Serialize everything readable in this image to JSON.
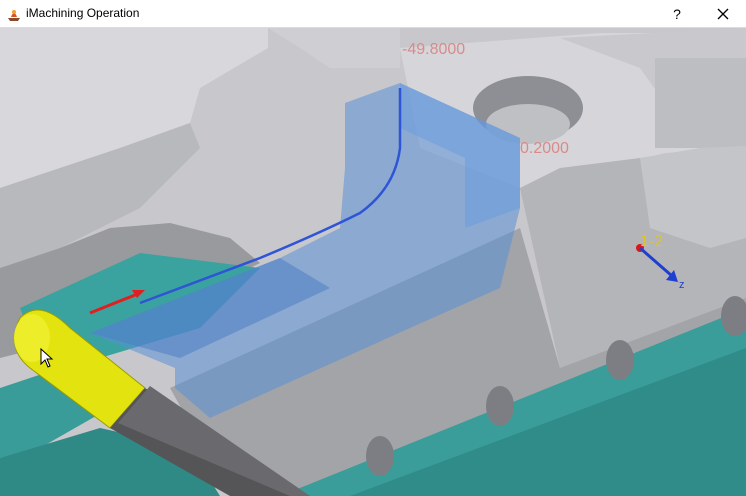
{
  "window": {
    "title": "iMachining Operation",
    "help_label": "?",
    "app_icon": "imachining-app-icon",
    "close_icon": "close-icon"
  },
  "viewport": {
    "dimension_labels": [
      "-49.8000",
      "0.2000"
    ],
    "axis_label": "1-2",
    "axis_letter": "z",
    "colors": {
      "part_face": "#d2d2d6",
      "part_face_light": "#e4e4e8",
      "part_wall": "#a7a8ac",
      "part_dark": "#8d8e93",
      "floor_teal": "#3b9d99",
      "floor_teal_dark": "#2e8a87",
      "selection": "#5a8fd6",
      "toolpath": "#2e55d6",
      "dim_text": "#d98b8b",
      "axis_text": "#e0c22a",
      "tool_yellow": "#e3e30f",
      "tool_holder": "#555558"
    }
  }
}
